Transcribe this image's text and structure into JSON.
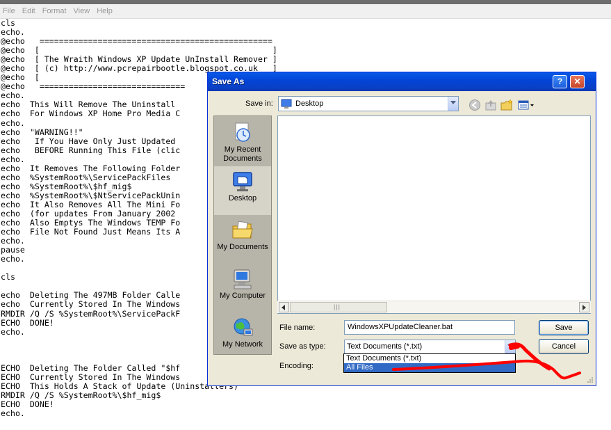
{
  "menu": [
    "File",
    "Edit",
    "Format",
    "View",
    "Help"
  ],
  "editor_lines": [
    "cls",
    "echo.",
    "@echo   ================================================",
    "@echo  [                                                ]",
    "@echo  [ The Wraith Windows XP Update UnInstall Remover ]",
    "@echo  [ (c) http://www.pcrepairbootle.blogspot.co.uk   ]",
    "@echo  [",
    "@echo   ==============================",
    "echo.",
    "echo  This Will Remove The Uninstall",
    "echo  For Windows XP Home Pro Media C",
    "echo.",
    "echo  \"WARNING!!\"",
    "echo   If You Have Only Just Updated",
    "echo   BEFORE Running This File (clic",
    "echo.",
    "echo  It Removes The Following Folder",
    "echo  %SystemRoot%\\ServicePackFiles",
    "echo  %SystemRoot%\\$hf_mig$",
    "echo  %SystemRoot%\\$NtServicePackUnin",
    "echo  It Also Removes All The Mini Fo",
    "echo  (for updates From January 2002",
    "echo  Also Emptys The Windows TEMP Fo",
    "echo  File Not Found Just Means Its A",
    "echo.",
    "pause",
    "echo.",
    "",
    "cls",
    "",
    "echo  Deleting The 497MB Folder Calle",
    "echo  Currently Stored In The Windows",
    "RMDIR /Q /S %SystemRoot%\\ServicePackF",
    "ECHO  DONE!",
    "echo.",
    "",
    "",
    "",
    "ECHO  Deleting The Folder Called \"$hf",
    "ECHO  Currently Stored In The Windows",
    "ECHO  This Holds A Stack of Update (Uninstallers)",
    "RMDIR /Q /S %SystemRoot%\\$hf_mig$",
    "ECHO  DONE!",
    "echo."
  ],
  "dialog": {
    "title": "Save As",
    "help_glyph": "?",
    "close_glyph": "✕",
    "save_in_label": "Save in:",
    "save_in_value": "Desktop",
    "places": [
      {
        "label": "My Recent Documents",
        "icon": "recent-documents-icon"
      },
      {
        "label": "Desktop",
        "icon": "desktop-icon"
      },
      {
        "label": "My Documents",
        "icon": "my-documents-icon"
      },
      {
        "label": "My Computer",
        "icon": "my-computer-icon"
      },
      {
        "label": "My Network",
        "icon": "my-network-icon"
      }
    ],
    "file_name_label": "File name:",
    "file_name_value": "WindowsXPUpdateCleaner.bat",
    "save_as_type_label": "Save as type:",
    "save_as_type_value": "Text Documents (*.txt)",
    "encoding_label": "Encoding:",
    "type_options": [
      "Text Documents (*.txt)",
      "All Files"
    ],
    "save_button": "Save",
    "cancel_button": "Cancel"
  },
  "colors": {
    "titlebar": "#0245d8",
    "dialog_bg": "#ece9d8",
    "selection": "#316ac5",
    "annotation": "#ff0000"
  }
}
